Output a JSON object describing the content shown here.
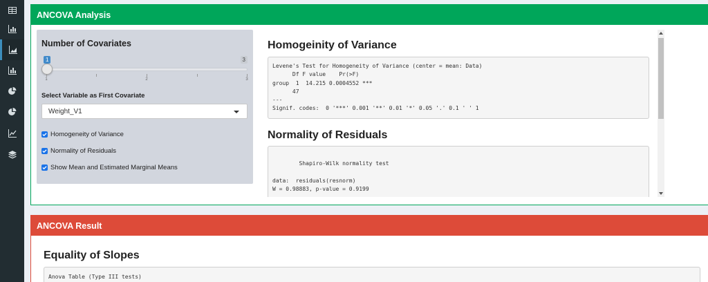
{
  "sidebar": {
    "items": [
      {
        "icon": "table-icon"
      },
      {
        "icon": "bar-chart-icon"
      },
      {
        "icon": "area-chart-icon"
      },
      {
        "icon": "bar-chart-icon"
      },
      {
        "icon": "pie-chart-icon"
      },
      {
        "icon": "pie-chart-icon"
      },
      {
        "icon": "line-chart-icon"
      },
      {
        "icon": "layers-icon"
      }
    ]
  },
  "analysis_box": {
    "title": "ANCOVA Analysis",
    "color": "#00a65a",
    "controls": {
      "covariates_label": "Number of Covariates",
      "slider": {
        "min": "1",
        "max": "3",
        "value": "1",
        "ticks": [
          "1",
          "2",
          "3"
        ]
      },
      "first_covariate_label": "Select Variable as First Covariate",
      "first_covariate_value": "Weight_V1",
      "checkboxes": [
        {
          "label": "Homogeneity of Variance",
          "checked": true
        },
        {
          "label": "Normality of Residuals",
          "checked": true
        },
        {
          "label": "Show Mean and Estimated Marginal Means",
          "checked": true
        }
      ]
    },
    "output": {
      "homogeneity_title": "Homogeinity of Variance",
      "homogeneity_text": "Levene's Test for Homogeneity of Variance (center = mean: Data)\n      Df F value    Pr(>F)    \ngroup  1  14.215 0.0004552 ***\n      47                      \n---\nSignif. codes:  0 '***' 0.001 '**' 0.01 '*' 0.05 '.' 0.1 ' ' 1",
      "normality_title": "Normality of Residuals",
      "normality_text": "\n\tShapiro-Wilk normality test\n\ndata:  residuals(resnorm)\nW = 0.98883, p-value = 0.9199"
    }
  },
  "result_box": {
    "title": "ANCOVA Result",
    "color": "#dd4b39",
    "section_title": "Equality of Slopes",
    "anova_text": "Anova Table (Type III tests)"
  }
}
